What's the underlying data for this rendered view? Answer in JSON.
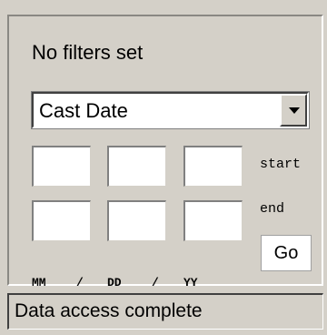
{
  "filter_panel": {
    "status_text": "No filters set",
    "field_select": {
      "selected": "Cast Date"
    },
    "start_label": "start",
    "end_label": "end",
    "go_label": "Go",
    "date_format": {
      "mm": "MM",
      "sep1": "/",
      "dd": "DD",
      "sep2": "/",
      "yy": "YY"
    }
  },
  "status_bar": {
    "text": "Data access complete"
  }
}
